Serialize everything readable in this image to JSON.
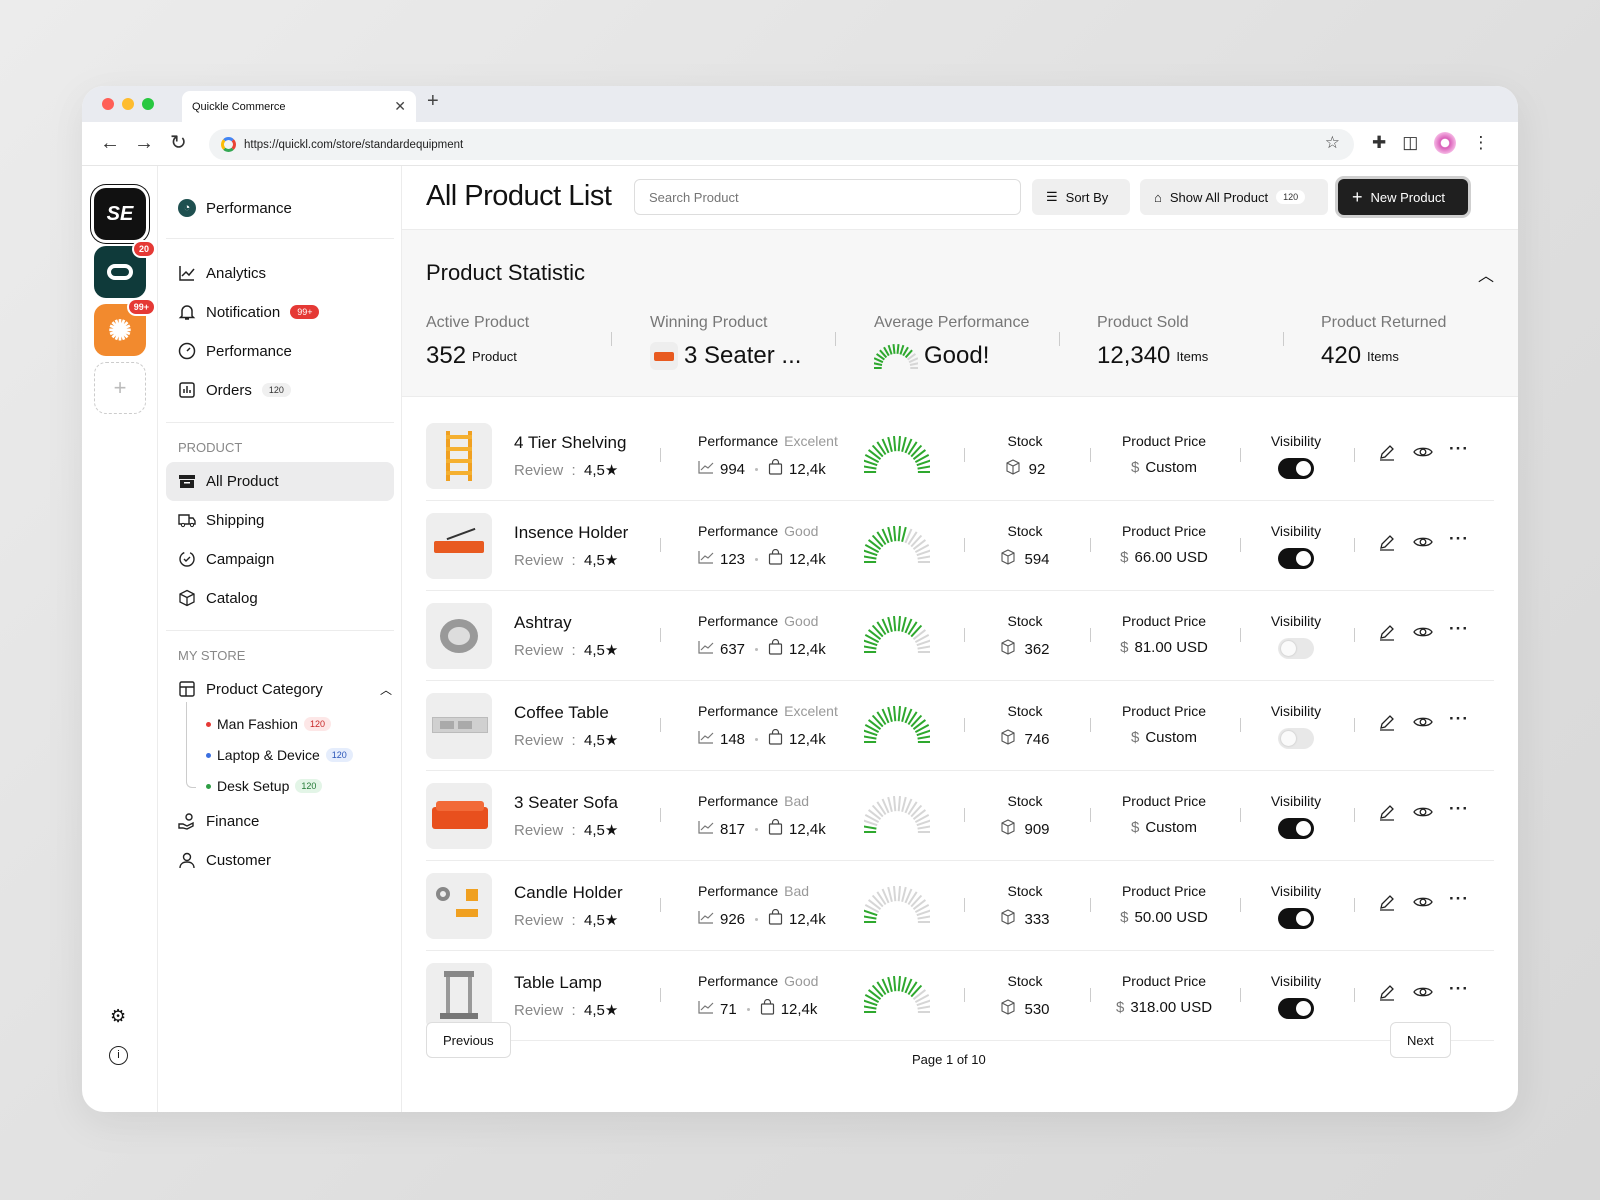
{
  "browser": {
    "tab_title": "Quickle Commerce",
    "url": "https://quickl.com/store/standardequipment"
  },
  "rail": {
    "app1": "SE",
    "app2_badge": "20",
    "app3_badge": "99+"
  },
  "sidebar": {
    "top": "Performance",
    "items": [
      {
        "label": "Analytics",
        "icon": "chart-icon"
      },
      {
        "label": "Notification",
        "icon": "bell-icon",
        "count": "99+"
      },
      {
        "label": "Performance",
        "icon": "gauge-icon"
      },
      {
        "label": "Orders",
        "icon": "orders-icon",
        "count": "120"
      }
    ],
    "product_section": "PRODUCT",
    "product_items": [
      {
        "label": "All Product",
        "icon": "box-icon"
      },
      {
        "label": "Shipping",
        "icon": "truck-icon"
      },
      {
        "label": "Campaign",
        "icon": "campaign-icon"
      },
      {
        "label": "Catalog",
        "icon": "cube-icon"
      }
    ],
    "store_section": "MY STORE",
    "category": "Product Category",
    "subcategories": [
      {
        "label": "Man Fashion",
        "count": "120",
        "color": "#e53935"
      },
      {
        "label": "Laptop & Device",
        "count": "120",
        "color": "#3b6fe0"
      },
      {
        "label": "Desk Setup",
        "count": "120",
        "color": "#2e9e45"
      }
    ],
    "bottom_items": [
      {
        "label": "Finance",
        "icon": "finance-icon"
      },
      {
        "label": "Customer",
        "icon": "user-icon"
      }
    ]
  },
  "header": {
    "title": "All Product List",
    "search_placeholder": "Search Product",
    "sort_label": "Sort By",
    "show_all_label": "Show All Product",
    "show_all_count": "120",
    "new_label": "New Product"
  },
  "stats": {
    "title": "Product Statistic",
    "items": [
      {
        "label": "Active Product",
        "value": "352",
        "unit": "Product"
      },
      {
        "label": "Winning Product",
        "value": "3 Seater ...",
        "unit": ""
      },
      {
        "label": "Average Performance",
        "value": "Good!",
        "unit": ""
      },
      {
        "label": "Product Sold",
        "value": "12,340",
        "unit": "Items"
      },
      {
        "label": "Product Returned",
        "value": "420",
        "unit": "Items"
      }
    ]
  },
  "table": {
    "perf_label": "Performance",
    "stock_label": "Stock",
    "price_label": "Product Price",
    "vis_label": "Visibility",
    "review_label": "Review",
    "rows": [
      {
        "name": "4 Tier Shelving",
        "rating": "4,5★",
        "quality": "Excelent",
        "trend": "994",
        "sold": "12,4k",
        "stock": "92",
        "currency": "$",
        "price": "Custom",
        "visible": true,
        "level": 1.0
      },
      {
        "name": "Insence Holder",
        "rating": "4,5★",
        "quality": "Good",
        "trend": "123",
        "sold": "12,4k",
        "stock": "594",
        "currency": "$",
        "price": "66.00 USD",
        "visible": true,
        "level": 0.6
      },
      {
        "name": "Ashtray",
        "rating": "4,5★",
        "quality": "Good",
        "trend": "637",
        "sold": "12,4k",
        "stock": "362",
        "currency": "$",
        "price": "81.00 USD",
        "visible": false,
        "level": 0.75
      },
      {
        "name": "Coffee Table",
        "rating": "4,5★",
        "quality": "Excelent",
        "trend": "148",
        "sold": "12,4k",
        "stock": "746",
        "currency": "$",
        "price": "Custom",
        "visible": false,
        "level": 1.0
      },
      {
        "name": "3 Seater Sofa",
        "rating": "4,5★",
        "quality": "Bad",
        "trend": "817",
        "sold": "12,4k",
        "stock": "909",
        "currency": "$",
        "price": "Custom",
        "visible": true,
        "level": 0.1
      },
      {
        "name": "Candle Holder",
        "rating": "4,5★",
        "quality": "Bad",
        "trend": "926",
        "sold": "12,4k",
        "stock": "333",
        "currency": "$",
        "price": "50.00 USD",
        "visible": true,
        "level": 0.15
      },
      {
        "name": "Table Lamp",
        "rating": "4,5★",
        "quality": "Good",
        "trend": "71",
        "sold": "12,4k",
        "stock": "530",
        "currency": "$",
        "price": "318.00 USD",
        "visible": true,
        "level": 0.75
      }
    ]
  },
  "pagination": {
    "prev": "Previous",
    "page": "Page 1 of 10",
    "next": "Next"
  },
  "colors": {
    "accent": "#1f1f1f",
    "gauge_on": "#2ea82e",
    "gauge_off": "#d6d6d6"
  }
}
